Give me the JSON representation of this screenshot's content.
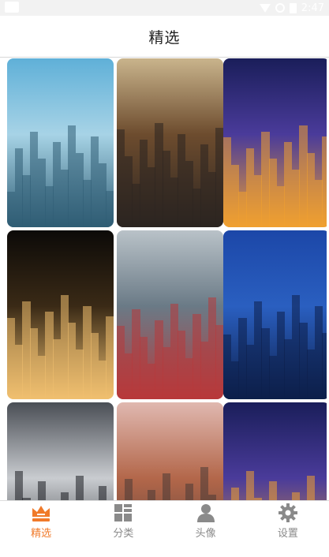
{
  "status_bar": {
    "time": "2:47",
    "icons": [
      "app-icon",
      "wifi-icon",
      "signal-icon",
      "battery-icon"
    ]
  },
  "header": {
    "title": "精选"
  },
  "gallery": {
    "items": [
      {
        "name": "city-skyline-aerial",
        "colors": [
          "#5fb0d8",
          "#a7d3e6",
          "#2f5d74"
        ]
      },
      {
        "name": "times-square-street",
        "colors": [
          "#c9b48c",
          "#6d4c2e",
          "#2c2521"
        ]
      },
      {
        "name": "night-city-lights-purple",
        "colors": [
          "#1a1e5a",
          "#4a3b9a",
          "#f0a030"
        ]
      },
      {
        "name": "night-city-dark",
        "colors": [
          "#0c0a08",
          "#3a2a16",
          "#f0c070"
        ]
      },
      {
        "name": "streetcar-city",
        "colors": [
          "#b9c2c8",
          "#6a7a86",
          "#b8383a"
        ]
      },
      {
        "name": "harbor-skyline-blue",
        "colors": [
          "#1c47a8",
          "#2a5fc0",
          "#0d1f4a"
        ]
      },
      {
        "name": "skyscraper-looking-down",
        "colors": [
          "#4a4e55",
          "#c9ccd0",
          "#1a1c20"
        ]
      },
      {
        "name": "city-buildings-dusk",
        "colors": [
          "#e0b8b0",
          "#b3674a",
          "#4a3a36"
        ]
      },
      {
        "name": "night-city-lights-purple-2",
        "colors": [
          "#1a1e5a",
          "#4a3b9a",
          "#f0a030"
        ]
      }
    ]
  },
  "tabs": [
    {
      "label": "精选",
      "icon": "crown-icon",
      "active": true
    },
    {
      "label": "分类",
      "icon": "category-grid-icon",
      "active": false
    },
    {
      "label": "头像",
      "icon": "person-icon",
      "active": false
    },
    {
      "label": "设置",
      "icon": "gear-icon",
      "active": false
    }
  ],
  "colors": {
    "accent": "#f07a2a",
    "inactive": "#8a8a8a",
    "header_text": "#222222"
  }
}
